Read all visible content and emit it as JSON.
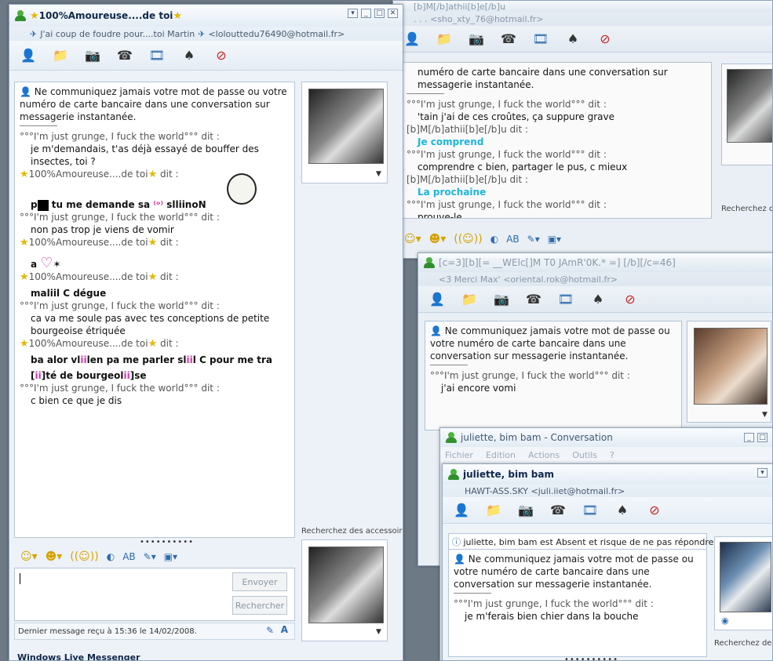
{
  "w2": {
    "title": "[b]M[/b]athii[b]e[/b]u",
    "subtitle": ". . . <sho_xty_76@hotmail.fr>",
    "lines": [
      {
        "k": "msg",
        "t": "numéro de carte bancaire dans une conversation sur"
      },
      {
        "k": "msg",
        "t": "messagerie instantanée."
      },
      {
        "k": "who",
        "t": "°°°I'm just grunge, I fuck the world°°° dit :"
      },
      {
        "k": "msg",
        "t": "'tain j'ai de ces croûtes, ça suppure grave"
      },
      {
        "k": "who",
        "t": "[b]M[/b]athii[b]e[/b]u dit :"
      },
      {
        "k": "cyan",
        "t": "Je comprend"
      },
      {
        "k": "who",
        "t": "°°°I'm just grunge, I fuck the world°°° dit :"
      },
      {
        "k": "msg",
        "t": "comprendre c bien, partager le pus, c mieux"
      },
      {
        "k": "who",
        "t": "[b]M[/b]athii[b]e[/b]u dit :"
      },
      {
        "k": "cyan",
        "t": "La prochaine"
      },
      {
        "k": "who",
        "t": "°°°I'm just grunge, I fuck the world°°° dit :"
      },
      {
        "k": "msg",
        "t": "prouve-le"
      }
    ],
    "accessories": "Recherchez des a"
  },
  "w3": {
    "title": "[c=3][b][=   __WElc[]M T0 JAmR'0K.*  =]  [/b][/c=46]",
    "subtitle": "<3 Merci Max' <oriental.rok@hotmail.fr>",
    "warning": "Ne communiquez jamais votre mot de passe ou votre numéro de carte bancaire dans une conversation sur messagerie instantanée.",
    "who": "°°°I'm just grunge, I fuck the world°°° dit :",
    "msg": "j'ai encore vomi"
  },
  "w4": {
    "title": "juliette, bim bam - Conversation",
    "menu": [
      "Fichier",
      "Edition",
      "Actions",
      "Outils",
      "?"
    ]
  },
  "w5": {
    "title": "juliette, bim bam",
    "subtitle": "HAWT-ASS.SKY <juli.iiet@hotmail.fr>",
    "notice": "juliette, bim bam est Absent et risque de ne pas répondre.",
    "warning": "Ne communiquez jamais votre mot de passe ou votre numéro de carte bancaire dans une conversation sur messagerie instantanée.",
    "who": "°°°I'm just grunge, I fuck the world°°° dit :",
    "msg": "je m'ferais bien chier dans la bouche",
    "accessories": "Recherchez des ac"
  },
  "w1": {
    "title": "100%Amoureuse....de toi",
    "subtitle": "J'ai coup de foudre pour....toi Martin",
    "email": "<lolouttedu76490@hotmail.fr>",
    "warning": "Ne communiquez jamais votre mot de passe ou votre numéro de carte bancaire dans une conversation sur messagerie instantanée.",
    "me": "°°°I'm just grunge, I fuck the world°°° dit :",
    "her": "100%Amoureuse....de toi",
    "dit": "dit :",
    "m1": "je m'demandais, t'as déjà essayé de bouffer des insectes, toi ?",
    "m2a": "p",
    "m2b": " tu me demande sa ",
    "m2c": " slliinoN",
    "m3": "non pas trop je viens de vomir",
    "m4": "a",
    "m5": "maliil C dégue",
    "m6": "ca va me soule pas avec tes conceptions de petite bourgeoise étriquée",
    "m7a": "ba alor vl",
    "m7b": "ii",
    "m7c": "len pa me parler sl",
    "m7d": "ii",
    "m7e": "l C pour me tra",
    "m8a": "[",
    "m8b": "ii",
    "m8c": "]té de bourgeol",
    "m8d": "ii",
    "m8e": "]se",
    "m9": "c bien ce que je dis",
    "send": "Envoyer",
    "search": "Rechercher",
    "accessories": "Recherchez des accessoires",
    "status": "Dernier message reçu à 15:36 le 14/02/2008.",
    "footer": "Windows Live Messenger"
  }
}
